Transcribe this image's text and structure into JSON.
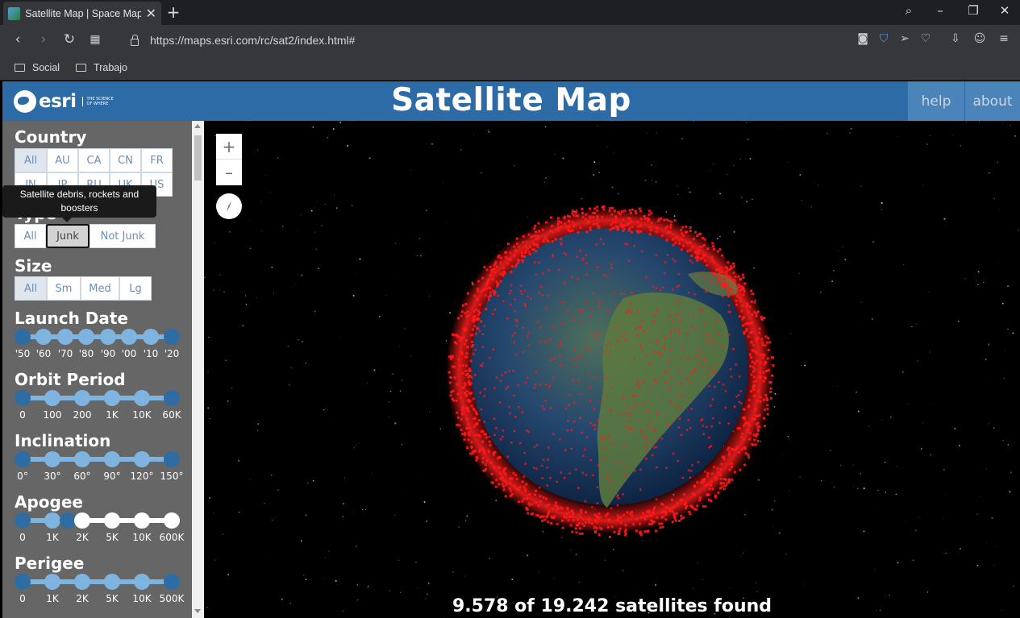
{
  "browser": {
    "tab_title": "Satellite Map | Space Map S",
    "url": "https://maps.esri.com/rc/sat2/index.html#",
    "bookmarks": [
      "Social",
      "Trabajo"
    ]
  },
  "header": {
    "logo_text": "esri",
    "logo_tagline": "THE SCIENCE OF WHERE",
    "title": "Satellite Map",
    "help_label": "help",
    "about_label": "about"
  },
  "sidebar": {
    "country": {
      "title": "Country",
      "options": [
        "All",
        "AU",
        "CA",
        "CN",
        "FR",
        "IN",
        "JP",
        "RU",
        "UK",
        "US"
      ],
      "active": "All"
    },
    "type": {
      "title": "Type",
      "options": [
        "All",
        "Junk",
        "Not Junk"
      ],
      "selected": "Junk",
      "tooltip": "Satellite debris, rockets and boosters"
    },
    "size": {
      "title": "Size",
      "options": [
        "All",
        "Sm",
        "Med",
        "Lg"
      ],
      "active": "All"
    },
    "launch_date": {
      "title": "Launch Date",
      "ticks": [
        "'50",
        "'60",
        "'70",
        "'80",
        "'90",
        "'00",
        "'10",
        "'20"
      ]
    },
    "orbit_period": {
      "title": "Orbit Period",
      "ticks": [
        "0",
        "100",
        "200",
        "1K",
        "10K",
        "60K"
      ]
    },
    "inclination": {
      "title": "Inclination",
      "ticks": [
        "0°",
        "30°",
        "60°",
        "90°",
        "120°",
        "150°"
      ]
    },
    "apogee": {
      "title": "Apogee",
      "ticks": [
        "0",
        "1K",
        "2K",
        "5K",
        "10K",
        "600K"
      ]
    },
    "perigee": {
      "title": "Perigee",
      "ticks": [
        "0",
        "1K",
        "2K",
        "5K",
        "10K",
        "500K"
      ]
    }
  },
  "map": {
    "zoom_in": "+",
    "zoom_out": "–",
    "status": "9.578 of 19.242 satellites found"
  },
  "colors": {
    "header_bg": "#2c6ba6",
    "sidebar_bg": "#666666",
    "debris": "#ff1a1a",
    "slider": "#7fb3e0",
    "slider_end": "#2e6da4"
  }
}
